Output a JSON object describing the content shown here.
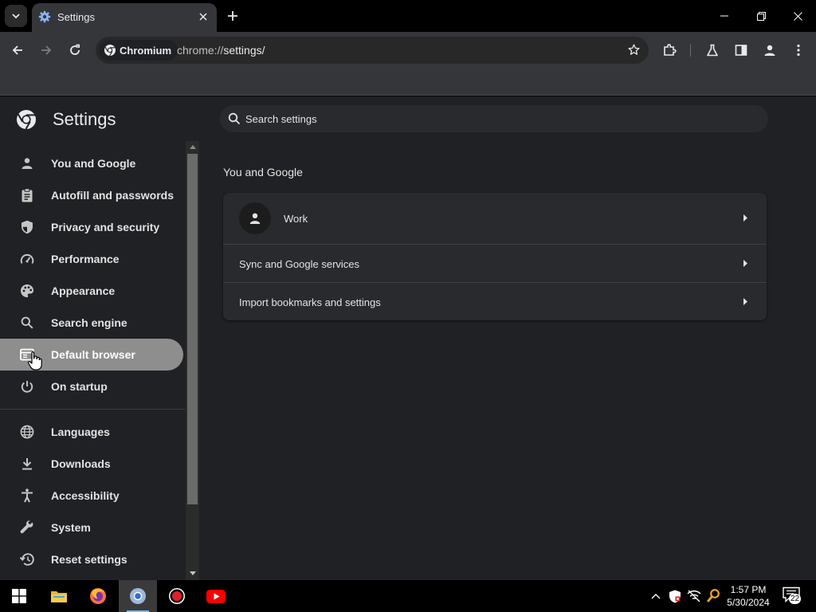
{
  "tab": {
    "title": "Settings",
    "icon": "gear-icon"
  },
  "toolbar": {
    "chip_label": "Chromium",
    "url_prefix": "chrome://",
    "url_path": "settings/"
  },
  "settings": {
    "title": "Settings",
    "search_placeholder": "Search settings",
    "nav": [
      {
        "label": "You and Google",
        "icon": "person-icon"
      },
      {
        "label": "Autofill and passwords",
        "icon": "clipboard-icon"
      },
      {
        "label": "Privacy and security",
        "icon": "shield-icon"
      },
      {
        "label": "Performance",
        "icon": "speedometer-icon"
      },
      {
        "label": "Appearance",
        "icon": "palette-icon"
      },
      {
        "label": "Search engine",
        "icon": "search-icon"
      },
      {
        "label": "Default browser",
        "icon": "browser-window-icon",
        "active": true
      },
      {
        "label": "On startup",
        "icon": "power-icon"
      },
      {
        "label": "Languages",
        "icon": "globe-icon"
      },
      {
        "label": "Downloads",
        "icon": "download-icon"
      },
      {
        "label": "Accessibility",
        "icon": "accessibility-icon"
      },
      {
        "label": "System",
        "icon": "wrench-icon"
      },
      {
        "label": "Reset settings",
        "icon": "history-icon"
      }
    ],
    "section_title": "You and Google",
    "rows": [
      {
        "label": "Work"
      },
      {
        "label": "Sync and Google services"
      },
      {
        "label": "Import bookmarks and settings"
      }
    ]
  },
  "taskbar": {
    "apps": [
      "windows-start-icon",
      "file-explorer-icon",
      "firefox-icon",
      "chromium-icon",
      "recorder-icon",
      "youtube-icon"
    ],
    "time": "1:57 PM",
    "date": "5/30/2024",
    "notification_count": "22"
  },
  "colors": {
    "accent": "#8ab4f8",
    "active_nav": "#8e8e8e",
    "page_bg": "#202124",
    "card_bg": "#292a2d"
  }
}
